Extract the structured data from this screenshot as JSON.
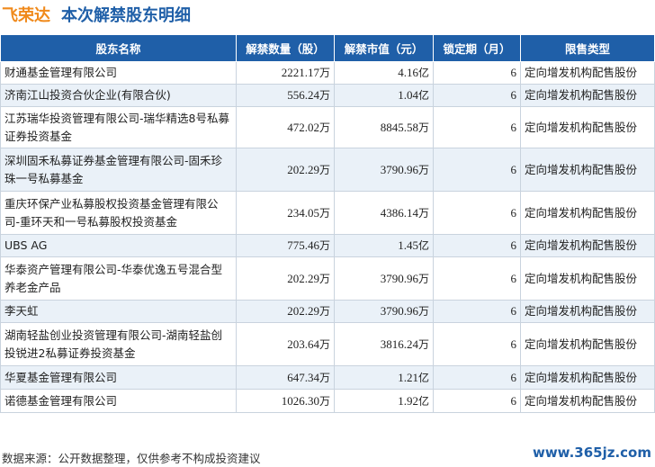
{
  "header": {
    "brand": "飞荣达",
    "title": "本次解禁股东明细"
  },
  "table": {
    "columns": [
      "股东名称",
      "解禁数量（股）",
      "解禁市值（元）",
      "锁定期（月）",
      "限售类型"
    ],
    "rows": [
      {
        "name": "财通基金管理有限公司",
        "qty_num": "2221.17",
        "qty_unit": "万",
        "val_num": "4.16",
        "val_unit": "亿",
        "lock": "6",
        "type": "定向增发机构配售股份"
      },
      {
        "name": "济南江山投资合伙企业(有限合伙)",
        "qty_num": "556.24",
        "qty_unit": "万",
        "val_num": "1.04",
        "val_unit": "亿",
        "lock": "6",
        "type": "定向增发机构配售股份"
      },
      {
        "name": "江苏瑞华投资管理有限公司-瑞华精选8号私募证券投资基金",
        "qty_num": "472.02",
        "qty_unit": "万",
        "val_num": "8845.58",
        "val_unit": "万",
        "lock": "6",
        "type": "定向增发机构配售股份"
      },
      {
        "name": "深圳固禾私募证券基金管理有限公司-固禾珍珠一号私募基金",
        "qty_num": "202.29",
        "qty_unit": "万",
        "val_num": "3790.96",
        "val_unit": "万",
        "lock": "6",
        "type": "定向增发机构配售股份"
      },
      {
        "name": "重庆环保产业私募股权投资基金管理有限公司-重环天和一号私募股权投资基金",
        "qty_num": "234.05",
        "qty_unit": "万",
        "val_num": "4386.14",
        "val_unit": "万",
        "lock": "6",
        "type": "定向增发机构配售股份"
      },
      {
        "name": "UBS AG",
        "qty_num": "775.46",
        "qty_unit": "万",
        "val_num": "1.45",
        "val_unit": "亿",
        "lock": "6",
        "type": "定向增发机构配售股份"
      },
      {
        "name": "华泰资产管理有限公司-华泰优逸五号混合型养老金产品",
        "qty_num": "202.29",
        "qty_unit": "万",
        "val_num": "3790.96",
        "val_unit": "万",
        "lock": "6",
        "type": "定向增发机构配售股份"
      },
      {
        "name": "李天虹",
        "qty_num": "202.29",
        "qty_unit": "万",
        "val_num": "3790.96",
        "val_unit": "万",
        "lock": "6",
        "type": "定向增发机构配售股份"
      },
      {
        "name": "湖南轻盐创业投资管理有限公司-湖南轻盐创投锐进2私募证券投资基金",
        "qty_num": "203.64",
        "qty_unit": "万",
        "val_num": "3816.24",
        "val_unit": "万",
        "lock": "6",
        "type": "定向增发机构配售股份"
      },
      {
        "name": "华夏基金管理有限公司",
        "qty_num": "647.34",
        "qty_unit": "万",
        "val_num": "1.21",
        "val_unit": "亿",
        "lock": "6",
        "type": "定向增发机构配售股份"
      },
      {
        "name": "诺德基金管理有限公司",
        "qty_num": "1026.30",
        "qty_unit": "万",
        "val_num": "1.92",
        "val_unit": "亿",
        "lock": "6",
        "type": "定向增发机构配售股份"
      }
    ]
  },
  "footer": {
    "source": "数据来源：公开数据整理，仅供参考不构成投资建议",
    "site": "www.365jz.com"
  },
  "colors": {
    "header_bg": "#1f5fa8",
    "brand": "#f08a1c",
    "row_alt": "#eaf1f8"
  }
}
